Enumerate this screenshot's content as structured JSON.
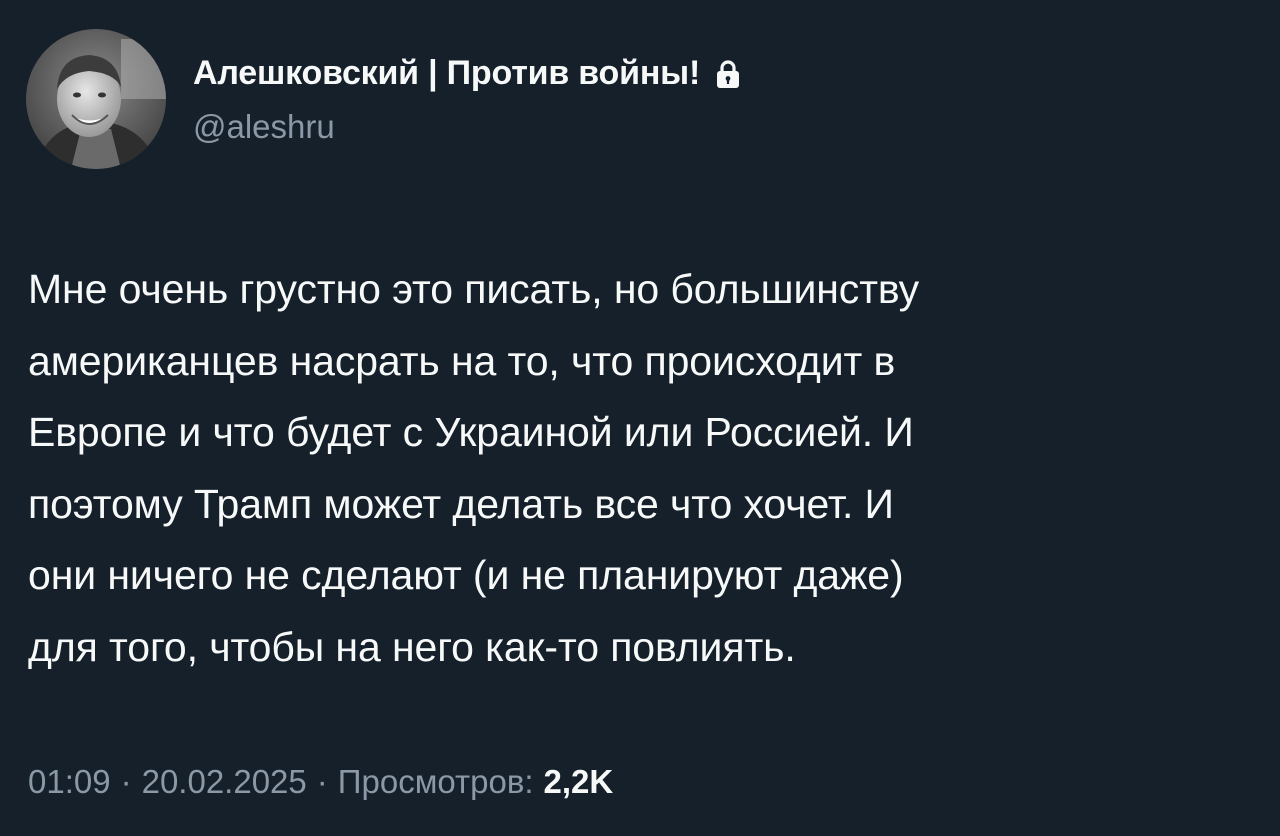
{
  "author": {
    "display_name": "Алешковский | Против войны!",
    "handle": "@aleshru",
    "avatar_icon": "profile-photo",
    "lock_icon": "lock-icon"
  },
  "tweet": {
    "text": "Мне очень грустно это писать, но большинству\nамериканцев насрать на то, что происходит в\nЕвропе и что будет с Украиной или Россией. И\nпоэтому Трамп может делать все что хочет. И\nони ничего не сделают (и не планируют даже)\nдля того, чтобы на него как-то повлиять."
  },
  "meta": {
    "time": "01:09",
    "separator": "·",
    "date": "20.02.2025",
    "views_label": "Просмотров:",
    "views_count": "2,2K"
  },
  "colors": {
    "background": "#15202b",
    "primary_text": "#f7f9f9",
    "secondary_text": "#8b98a5"
  }
}
